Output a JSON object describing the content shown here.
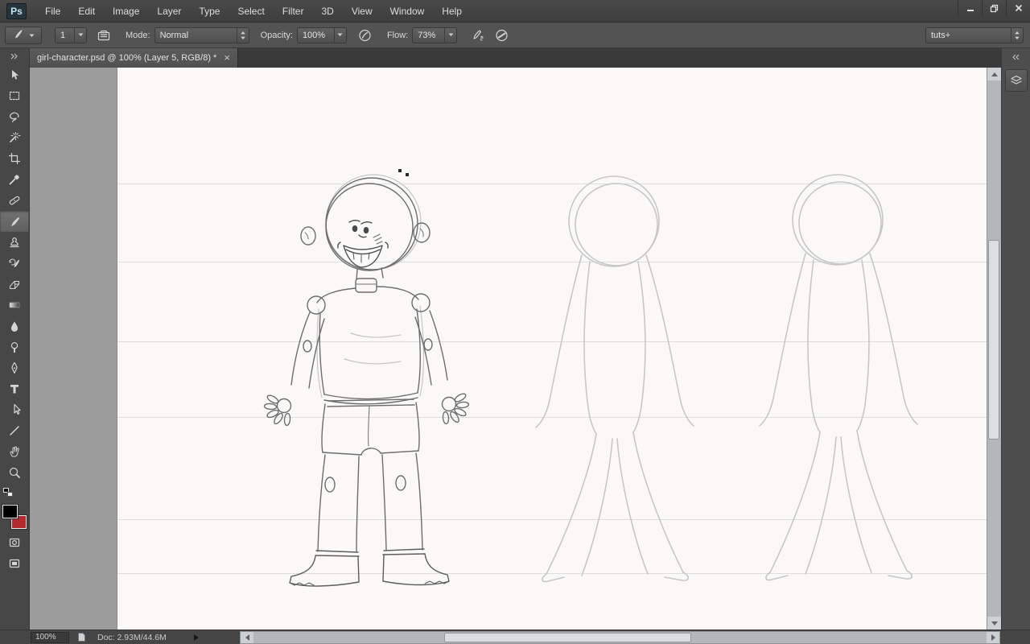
{
  "app": {
    "logo": "Ps"
  },
  "menubar": {
    "items": [
      "File",
      "Edit",
      "Image",
      "Layer",
      "Type",
      "Select",
      "Filter",
      "3D",
      "View",
      "Window",
      "Help"
    ]
  },
  "options": {
    "brush_size": "1",
    "mode_label": "Mode:",
    "mode_value": "Normal",
    "opacity_label": "Opacity:",
    "opacity_value": "100%",
    "flow_label": "Flow:",
    "flow_value": "73%",
    "workspace_value": "tuts+"
  },
  "tab": {
    "title": "girl-character.psd @ 100% (Layer 5, RGB/8) *",
    "close_glyph": "×"
  },
  "toolbar": {
    "tools": [
      "move",
      "rectangular-marquee",
      "lasso",
      "magic-wand",
      "crop",
      "eyedropper",
      "spot-healing-brush",
      "brush",
      "clone-stamp",
      "history-brush",
      "eraser",
      "gradient",
      "blur",
      "dodge",
      "pen",
      "type",
      "path-selection",
      "line",
      "hand",
      "zoom"
    ],
    "selected_tool": "brush",
    "foreground_color": "#000000",
    "background_color": "#b32a2e"
  },
  "status": {
    "zoom": "100%",
    "doc_info": "Doc: 2.93M/44.6M"
  }
}
